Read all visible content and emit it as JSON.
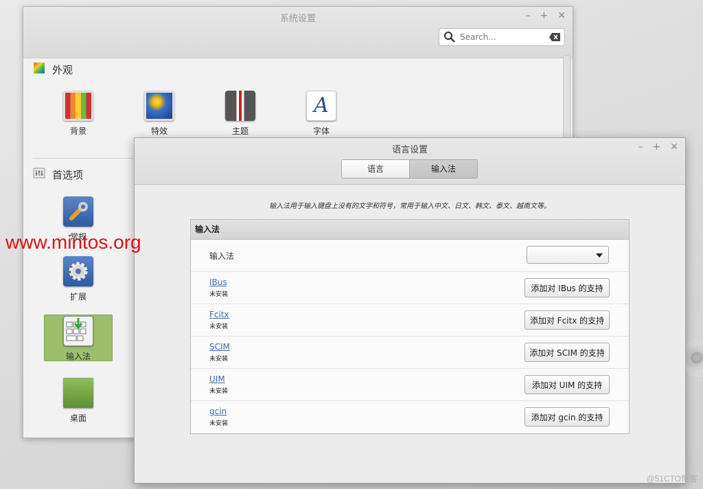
{
  "system_settings": {
    "title": "系统设置",
    "controls": [
      "–",
      "+",
      "✕"
    ],
    "search": {
      "placeholder": "Search...",
      "value": ""
    },
    "appearance": {
      "heading": "外观",
      "items": [
        {
          "label": "背景",
          "icon": "backgrounds-icon"
        },
        {
          "label": "特效",
          "icon": "effects-icon"
        },
        {
          "label": "主题",
          "icon": "themes-icon"
        },
        {
          "label": "字体",
          "icon": "fonts-icon"
        }
      ]
    },
    "preferences": {
      "heading": "首选项",
      "items": [
        {
          "label": "常规",
          "icon": "general-icon"
        },
        {
          "label": "扩展",
          "icon": "extensions-icon"
        },
        {
          "label": "输入法",
          "icon": "input-method-icon",
          "selected": true
        },
        {
          "label": "桌面",
          "icon": "desktop-icon"
        }
      ]
    }
  },
  "language_settings": {
    "title": "语言设置",
    "controls": [
      "–",
      "+",
      "✕"
    ],
    "tabs": [
      {
        "label": "语言",
        "active": false
      },
      {
        "label": "输入法",
        "active": true
      }
    ],
    "description": "输入法用于输入键盘上没有的文字和符号，常用于输入中文、日文、韩文、泰文、越南文等。",
    "panel": {
      "heading": "输入法",
      "selector_label": "输入法",
      "selector_value": "",
      "methods": [
        {
          "name": "IBus",
          "status": "未安装",
          "button": "添加对 IBus 的支持"
        },
        {
          "name": "Fcitx",
          "status": "未安装",
          "button": "添加对 Fcitx 的支持"
        },
        {
          "name": "SCIM",
          "status": "未安装",
          "button": "添加对 SCIM 的支持"
        },
        {
          "name": "UIM",
          "status": "未安装",
          "button": "添加对 UIM 的支持"
        },
        {
          "name": "gcin",
          "status": "未安装",
          "button": "添加对 gcin 的支持"
        }
      ]
    }
  },
  "watermarks": {
    "url": "www.mintos.org",
    "blog": "@51CTO博客"
  },
  "colors": {
    "selected_item": "#9cbf6a",
    "link": "#3c6cb0",
    "watermark": "#e01010"
  }
}
